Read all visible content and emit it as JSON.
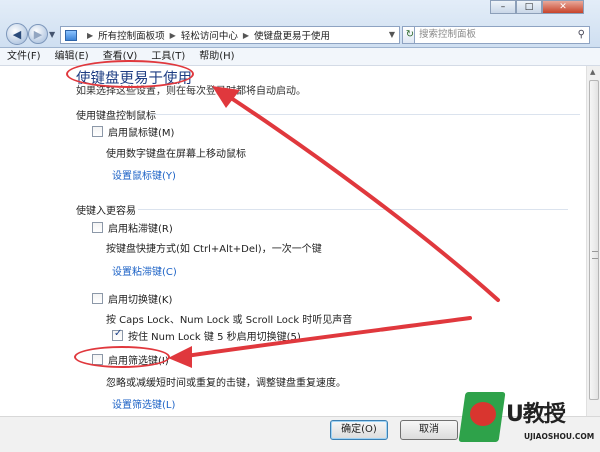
{
  "window": {
    "minimize": "–",
    "maximize": "□",
    "close": "✕"
  },
  "address": {
    "crumbs": [
      "所有控制面板项",
      "轻松访问中心",
      "使键盘更易于使用"
    ],
    "search_placeholder": "搜索控制面板"
  },
  "menu": [
    "文件(F)",
    "编辑(E)",
    "查看(V)",
    "工具(T)",
    "帮助(H)"
  ],
  "page": {
    "title": "使键盘更易于使用",
    "description": "如果选择这些设置，则在每次登录时都将自动启动。"
  },
  "sections": [
    {
      "title": "使用键盘控制鼠标",
      "option": "启用鼠标键(M)",
      "checked": false,
      "description": "使用数字键盘在屏幕上移动鼠标",
      "link": "设置鼠标键(Y)"
    },
    {
      "title": "使键入更容易",
      "sticky": {
        "option": "启用粘滞键(R)",
        "checked": false,
        "description": "按键盘快捷方式(如 Ctrl+Alt+Del)，一次一个键",
        "link": "设置粘滞键(C)"
      },
      "toggle": {
        "option": "启用切换键(K)",
        "checked": false,
        "description": "按 Caps Lock、Num Lock 或 Scroll Lock 时听见声音",
        "sub_option": "按住 Num Lock 键 5 秒启用切换键(5)",
        "sub_checked": true
      },
      "filter": {
        "option": "启用筛选键(I)",
        "checked": false,
        "description": "忽略或减缓短时间或重复的击键，调整键盘重复速度。",
        "link": "设置筛选键(L)"
      }
    }
  ],
  "buttons": {
    "ok": "确定(O)",
    "cancel": "取消"
  },
  "watermark": {
    "brand": "U教授",
    "url": "UJIAOSHOU.COM"
  },
  "colors": {
    "annotation": "#e0383d",
    "link": "#1c62c6",
    "title": "#1e3d83"
  }
}
